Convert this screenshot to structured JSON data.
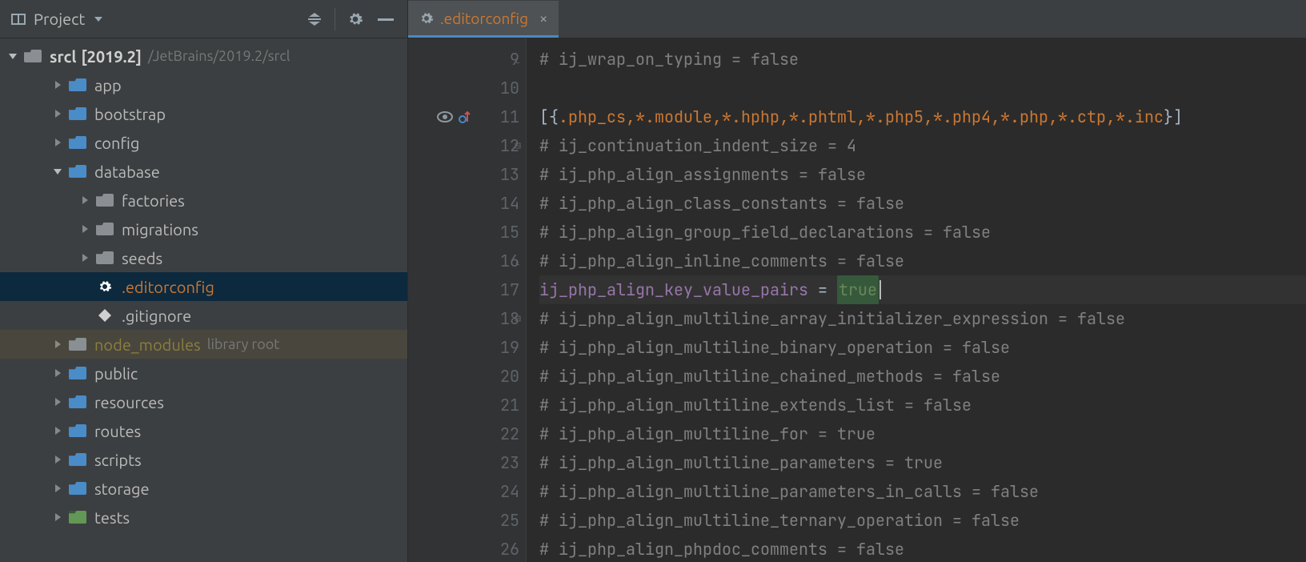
{
  "sidebar": {
    "title": "Project",
    "root": {
      "name": "srcl",
      "version": "[2019.2]",
      "path": "/JetBrains/2019.2/srcl"
    },
    "items": [
      {
        "name": "app",
        "depth": 1,
        "arrow": "right",
        "folder": "blue"
      },
      {
        "name": "bootstrap",
        "depth": 1,
        "arrow": "right",
        "folder": "blue"
      },
      {
        "name": "config",
        "depth": 1,
        "arrow": "right",
        "folder": "blue"
      },
      {
        "name": "database",
        "depth": 1,
        "arrow": "down",
        "folder": "blue"
      },
      {
        "name": "factories",
        "depth": 2,
        "arrow": "right",
        "folder": "grey"
      },
      {
        "name": "migrations",
        "depth": 2,
        "arrow": "right",
        "folder": "grey"
      },
      {
        "name": "seeds",
        "depth": 2,
        "arrow": "right",
        "folder": "grey"
      },
      {
        "name": ".editorconfig",
        "depth": 2,
        "arrow": "none",
        "icon": "gear",
        "orange": true,
        "selected": true
      },
      {
        "name": ".gitignore",
        "depth": 2,
        "arrow": "none",
        "icon": "rhom"
      },
      {
        "name": "node_modules",
        "depth": 1,
        "arrow": "right",
        "folder": "grey",
        "lib": true,
        "suffix": "library root"
      },
      {
        "name": "public",
        "depth": 1,
        "arrow": "right",
        "folder": "blue"
      },
      {
        "name": "resources",
        "depth": 1,
        "arrow": "right",
        "folder": "blue"
      },
      {
        "name": "routes",
        "depth": 1,
        "arrow": "right",
        "folder": "blue"
      },
      {
        "name": "scripts",
        "depth": 1,
        "arrow": "right",
        "folder": "blue"
      },
      {
        "name": "storage",
        "depth": 1,
        "arrow": "right",
        "folder": "blue"
      },
      {
        "name": "tests",
        "depth": 1,
        "arrow": "right",
        "folder": "green"
      }
    ]
  },
  "tab": {
    "title": ".editorconfig"
  },
  "editor": {
    "lines": [
      {
        "n": 9,
        "fold": "end",
        "type": "comment",
        "text": "# ij_wrap_on_typing = false"
      },
      {
        "n": 10,
        "type": "blank",
        "text": ""
      },
      {
        "n": 11,
        "marks": true,
        "type": "section",
        "text": "[{.php_cs,*.module,*.hphp,*.phtml,*.php5,*.php4,*.php,*.ctp,*.inc}]"
      },
      {
        "n": 12,
        "fold": "start",
        "type": "comment",
        "text": "# ij_continuation_indent_size = 4"
      },
      {
        "n": 13,
        "type": "comment",
        "text": "# ij_php_align_assignments = false"
      },
      {
        "n": 14,
        "type": "comment",
        "text": "# ij_php_align_class_constants = false"
      },
      {
        "n": 15,
        "type": "comment",
        "text": "# ij_php_align_group_field_declarations = false"
      },
      {
        "n": 16,
        "fold": "end",
        "type": "comment",
        "text": "# ij_php_align_inline_comments = false"
      },
      {
        "n": 17,
        "type": "kv",
        "hl": true,
        "key": "ij_php_align_key_value_pairs",
        "eq": " = ",
        "val": "true"
      },
      {
        "n": 18,
        "fold": "start",
        "type": "comment",
        "text": "# ij_php_align_multiline_array_initializer_expression = false"
      },
      {
        "n": 19,
        "type": "comment",
        "text": "# ij_php_align_multiline_binary_operation = false"
      },
      {
        "n": 20,
        "type": "comment",
        "text": "# ij_php_align_multiline_chained_methods = false"
      },
      {
        "n": 21,
        "type": "comment",
        "text": "# ij_php_align_multiline_extends_list = false"
      },
      {
        "n": 22,
        "type": "comment",
        "text": "# ij_php_align_multiline_for = true"
      },
      {
        "n": 23,
        "type": "comment",
        "text": "# ij_php_align_multiline_parameters = true"
      },
      {
        "n": 24,
        "type": "comment",
        "text": "# ij_php_align_multiline_parameters_in_calls = false"
      },
      {
        "n": 25,
        "type": "comment",
        "text": "# ij_php_align_multiline_ternary_operation = false"
      },
      {
        "n": 26,
        "type": "comment",
        "text": "# ij_php_align_phpdoc_comments = false"
      }
    ]
  }
}
